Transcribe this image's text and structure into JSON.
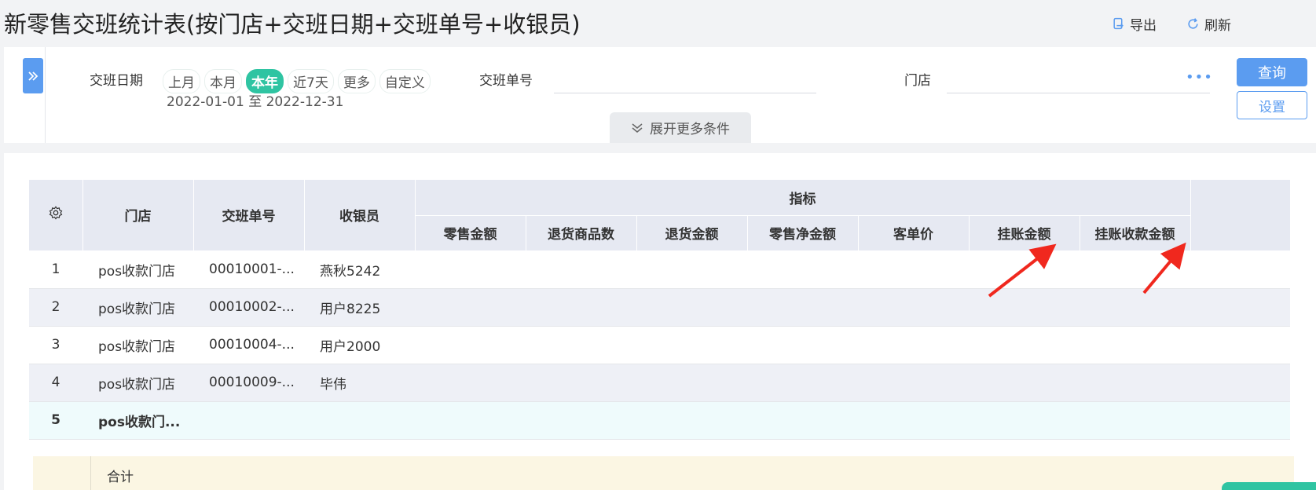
{
  "page": {
    "title": "新零售交班统计表(按门店+交班日期+交班单号+收银员)"
  },
  "actions": {
    "export": "导出",
    "refresh": "刷新"
  },
  "filters": {
    "date_label": "交班日期",
    "date_options": [
      "上月",
      "本月",
      "本年",
      "近7天",
      "更多",
      "自定义"
    ],
    "date_selected": "本年",
    "date_range": "2022-01-01 至 2022-12-31",
    "shift_no_label": "交班单号",
    "shift_no_value": "",
    "store_label": "门店",
    "store_value": "",
    "more_conditions": "展开更多条件"
  },
  "buttons": {
    "query": "查询",
    "settings": "设置"
  },
  "table": {
    "headers": {
      "store": "门店",
      "shift_no": "交班单号",
      "cashier": "收银员",
      "indicators": "指标"
    },
    "indicator_columns": [
      "零售金额",
      "退货商品数",
      "退货金额",
      "零售净金额",
      "客单价",
      "挂账金额",
      "挂账收款金额"
    ],
    "rows": [
      {
        "idx": "1",
        "store": "pos收款门店",
        "shift_no": "00010001-...",
        "cashier": "燕秋5242"
      },
      {
        "idx": "2",
        "store": "pos收款门店",
        "shift_no": "00010002-...",
        "cashier": "用户8225"
      },
      {
        "idx": "3",
        "store": "pos收款门店",
        "shift_no": "00010004-...",
        "cashier": "用户2000"
      },
      {
        "idx": "4",
        "store": "pos收款门店",
        "shift_no": "00010009-...",
        "cashier": "毕伟"
      },
      {
        "idx": "5",
        "store": "pos收款门...",
        "shift_no": "",
        "cashier": ""
      }
    ],
    "summary_label": "合计"
  },
  "colors": {
    "accent": "#5b9cf0",
    "chip_active": "#2fc4a2",
    "arrow": "#f0281e",
    "header_bg": "#e6e9f2"
  }
}
